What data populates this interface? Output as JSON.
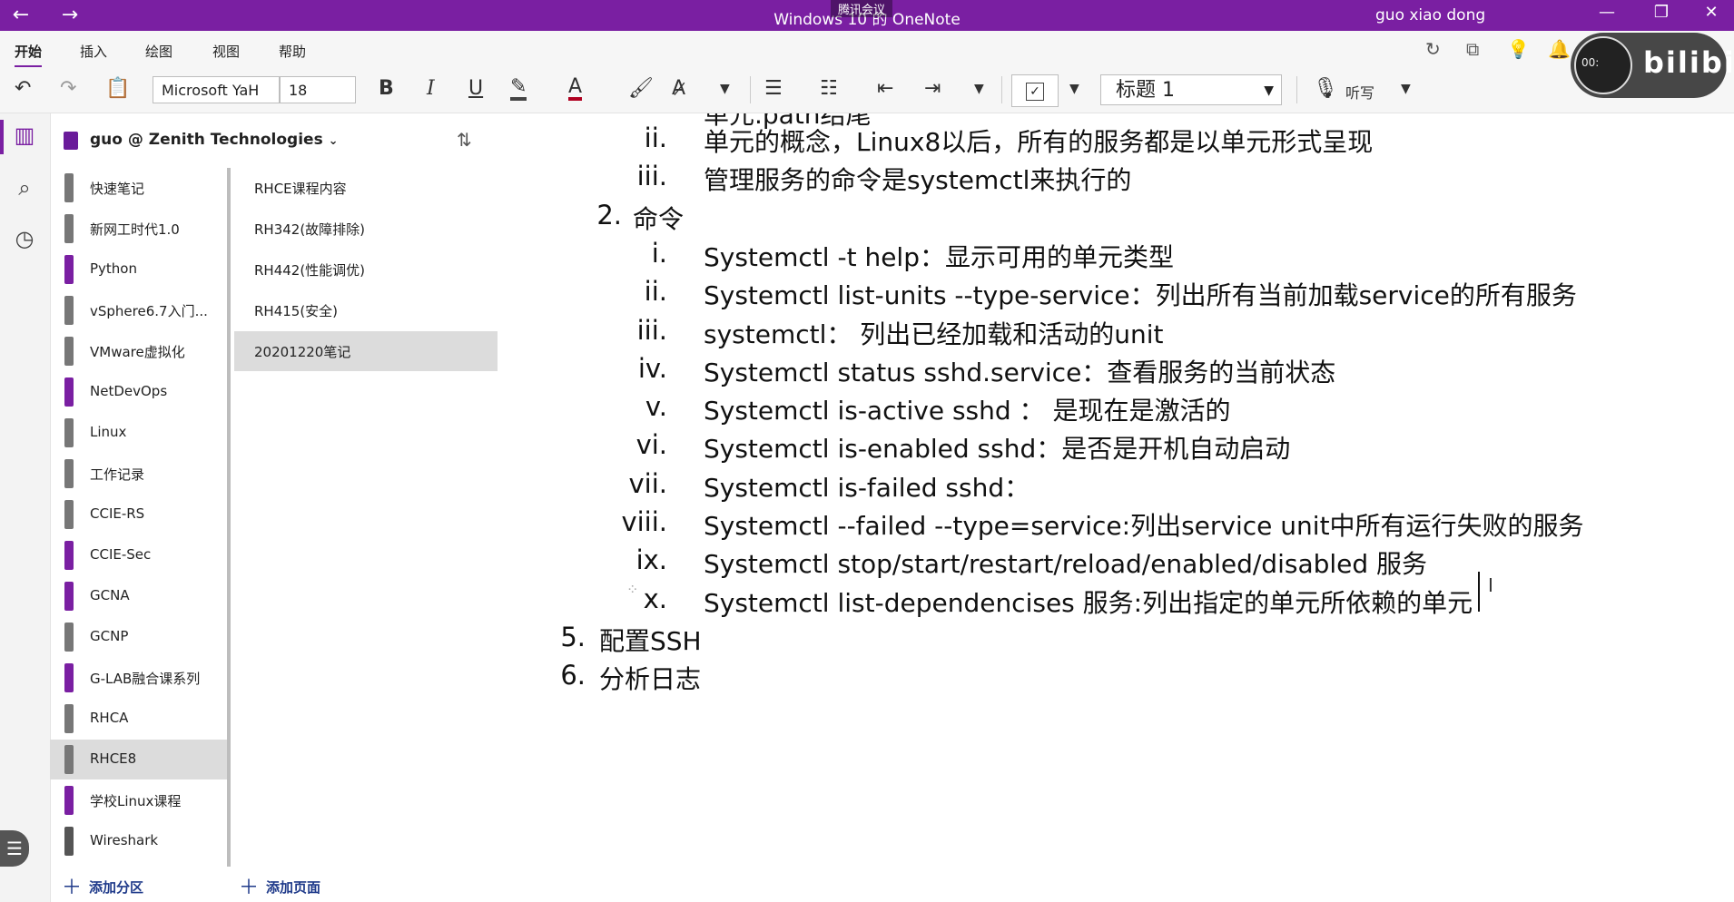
{
  "titlebar": {
    "back": "←",
    "forward": "→",
    "title": "Windows 10 的 OneNote",
    "user": "guo xiao dong",
    "minimize": "—",
    "restore": "❐",
    "close": "✕"
  },
  "meeting_overlay": "腾讯会议",
  "menu": {
    "tabs": [
      "开始",
      "插入",
      "绘图",
      "视图",
      "帮助"
    ]
  },
  "ribbon_right": [
    "↻",
    "⧉",
    "💡",
    "🔔"
  ],
  "toolbar": {
    "font_name": "Microsoft YaH",
    "font_size": "18",
    "bold": "B",
    "italic": "I",
    "underline": "U",
    "style": "标题 1",
    "dictate": "听写"
  },
  "notebook": {
    "name": "guo @ Zenith Technologies"
  },
  "sections": [
    {
      "label": "快速笔记",
      "color": "#777777"
    },
    {
      "label": "新网工时代1.0",
      "color": "#777777"
    },
    {
      "label": "Python",
      "color": "#7a1fa2"
    },
    {
      "label": "vSphere6.7入门...",
      "color": "#777777"
    },
    {
      "label": "VMware虚拟化",
      "color": "#777777"
    },
    {
      "label": "NetDevOps",
      "color": "#7a1fa2"
    },
    {
      "label": "Linux",
      "color": "#777777"
    },
    {
      "label": "工作记录",
      "color": "#777777"
    },
    {
      "label": "CCIE-RS",
      "color": "#777777"
    },
    {
      "label": "CCIE-Sec",
      "color": "#7a1fa2"
    },
    {
      "label": "GCNA",
      "color": "#7a1fa2"
    },
    {
      "label": "GCNP",
      "color": "#777777"
    },
    {
      "label": "G-LAB融合课系列",
      "color": "#7a1fa2"
    },
    {
      "label": "RHCA",
      "color": "#777777"
    },
    {
      "label": "RHCE8",
      "color": "#777777"
    },
    {
      "label": "学校Linux课程",
      "color": "#7a1fa2"
    },
    {
      "label": "Wireshark",
      "color": "#555555"
    }
  ],
  "pages": [
    "RHCE课程内容",
    "RH342(故障排除)",
    "RH442(性能调优)",
    "RH415(安全)",
    "20201220笔记"
  ],
  "add_section": "添加分区",
  "add_page": "添加页面",
  "content": {
    "top_cut": "单元.path结尾",
    "lines": [
      {
        "num": "ii.",
        "text": "单元的概念，Linux8以后，所有的服务都是以单元形式呈现",
        "level": 3
      },
      {
        "num": "iii.",
        "text": "管理服务的命令是systemctl来执行的",
        "level": 3
      },
      {
        "num": "2.",
        "text": "命令",
        "level": 2
      },
      {
        "num": "i.",
        "text": "Systemctl -t help：显示可用的单元类型",
        "level": 3
      },
      {
        "num": "ii.",
        "text": "Systemctl list-units --type-service：列出所有当前加载service的所有服务",
        "level": 3
      },
      {
        "num": "iii.",
        "text": "systemctl：  列出已经加载和活动的unit",
        "level": 3
      },
      {
        "num": "iv.",
        "text": "Systemctl status sshd.service：查看服务的当前状态",
        "level": 3
      },
      {
        "num": "v.",
        "text": "Systemctl is-active sshd ： 是现在是激活的",
        "level": 3
      },
      {
        "num": "vi.",
        "text": "Systemctl is-enabled sshd：是否是开机自动启动",
        "level": 3
      },
      {
        "num": "vii.",
        "text": "Systemctl is-failed sshd：",
        "level": 3
      },
      {
        "num": "viii.",
        "text": "Systemctl --failed --type=service:列出service unit中所有运行失败的服务",
        "level": 3
      },
      {
        "num": "ix.",
        "text": "Systemctl  stop/start/restart/reload/enabled/disabled 服务",
        "level": 3
      },
      {
        "num": "x.",
        "text": "Systemctl list-dependencises 服务:列出指定的单元所依赖的单元",
        "level": 3
      },
      {
        "num": "5.",
        "text": "配置SSH",
        "level": 1
      },
      {
        "num": "6.",
        "text": "分析日志",
        "level": 1
      }
    ]
  },
  "video_widget": {
    "time": "00:",
    "logo": "bilibili"
  }
}
